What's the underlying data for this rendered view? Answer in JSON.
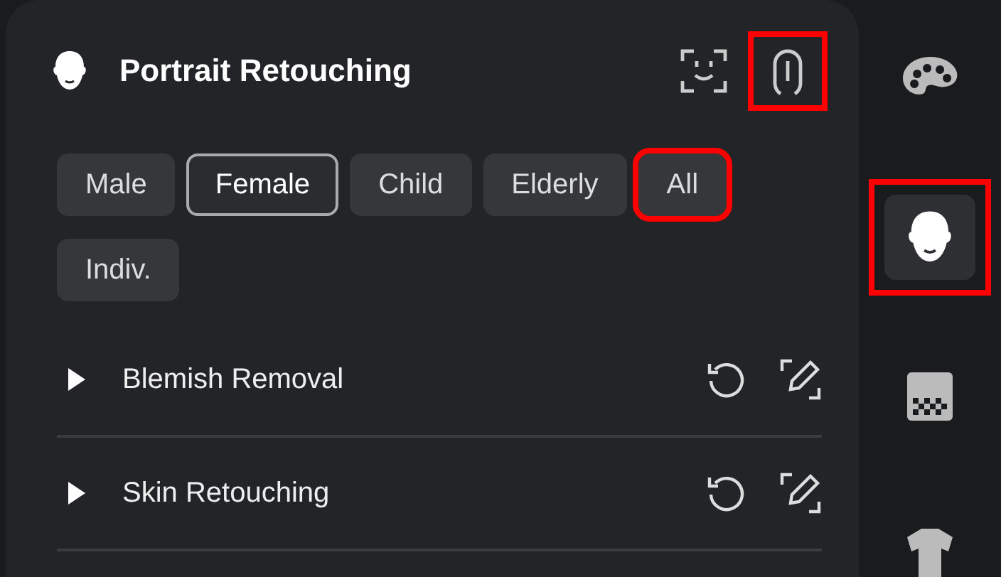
{
  "panel": {
    "title": "Portrait Retouching",
    "tools": [
      {
        "kind": "face-scan",
        "highlighted": false
      },
      {
        "kind": "touch",
        "highlighted": true
      }
    ]
  },
  "chips": [
    {
      "label": "Male",
      "selected": false,
      "highlighted": false
    },
    {
      "label": "Female",
      "selected": true,
      "highlighted": false
    },
    {
      "label": "Child",
      "selected": false,
      "highlighted": false
    },
    {
      "label": "Elderly",
      "selected": false,
      "highlighted": false
    },
    {
      "label": "All",
      "selected": false,
      "highlighted": true
    },
    {
      "label": "Indiv.",
      "selected": false,
      "highlighted": false
    }
  ],
  "sections": [
    {
      "title": "Blemish Removal",
      "expanded": false
    },
    {
      "title": "Skin Retouching",
      "expanded": false
    }
  ],
  "sidebar": {
    "items": [
      {
        "kind": "palette",
        "selected": false,
        "highlighted": false
      },
      {
        "kind": "portrait",
        "selected": true,
        "highlighted": true
      },
      {
        "kind": "gradient",
        "selected": false,
        "highlighted": false
      },
      {
        "kind": "shirt",
        "selected": false,
        "highlighted": false
      }
    ]
  }
}
